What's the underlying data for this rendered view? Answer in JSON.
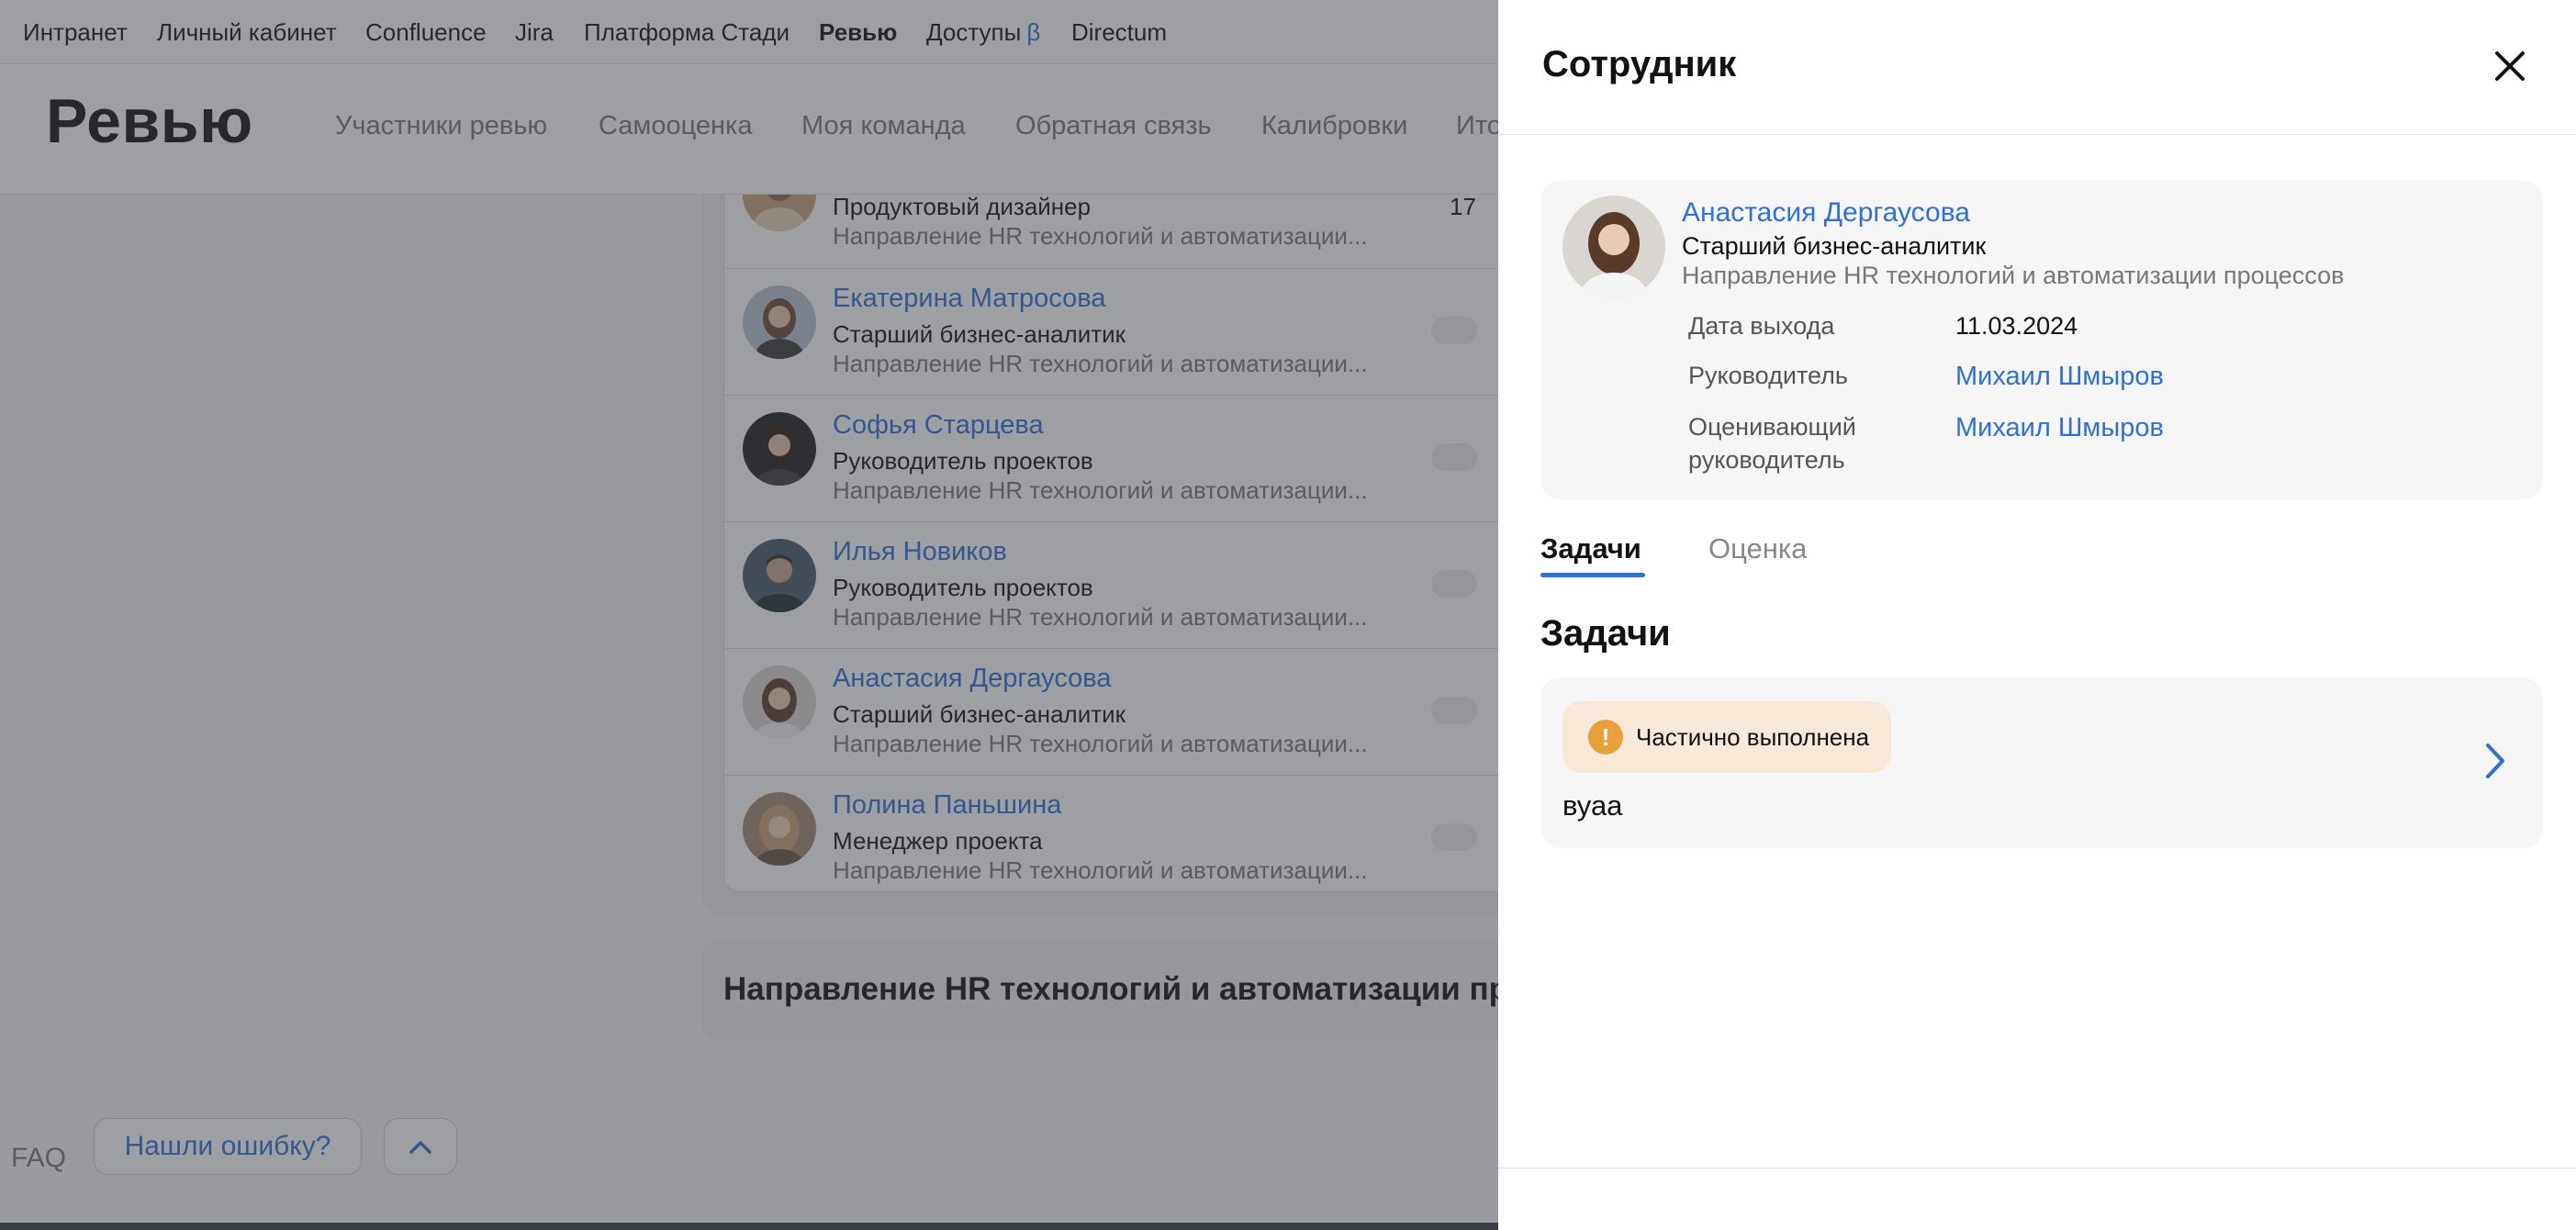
{
  "top_nav": {
    "items": [
      "Интранет",
      "Личный кабинет",
      "Confluence",
      "Jira",
      "Платформа Стади",
      "Ревью",
      "Доступы",
      "Directum"
    ],
    "active": "Ревью",
    "beta_mark": "β"
  },
  "page": {
    "title": "Ревью",
    "tabs": [
      "Участники ревью",
      "Самооценка",
      "Моя команда",
      "Обратная связь",
      "Калибровки",
      "Ито"
    ]
  },
  "employee_list": {
    "partial_row": {
      "role": "Продуктовый дизайнер",
      "department": "Направление HR технологий и автоматизации...",
      "count": "17"
    },
    "rows": [
      {
        "name": "Екатерина Матросова",
        "role": "Старший бизнес-аналитик",
        "department": "Направление HR технологий и автоматизации..."
      },
      {
        "name": "Софья Старцева",
        "role": "Руководитель проектов",
        "department": "Направление HR технологий и автоматизации..."
      },
      {
        "name": "Илья Новиков",
        "role": "Руководитель проектов",
        "department": "Направление HR технологий и автоматизации..."
      },
      {
        "name": "Анастасия Дергаусова",
        "role": "Старший бизнес-аналитик",
        "department": "Направление HR технологий и автоматизации..."
      },
      {
        "name": "Полина Паньшина",
        "role": "Менеджер проекта",
        "department": "Направление HR технологий и автоматизации..."
      }
    ]
  },
  "section_heading": "Направление HR технологий и автоматизации про",
  "footer": {
    "faq": "FAQ",
    "report_error": "Нашли ошибку?",
    "scroll_up_icon": "chevron-up-icon"
  },
  "drawer": {
    "title": "Сотрудник",
    "close_icon": "close-icon",
    "employee": {
      "name": "Анастасия Дергаусова",
      "role": "Старший бизнес-аналитик",
      "department": "Направление HR технологий и автоматизации процессов",
      "start_date_label": "Дата выхода",
      "start_date": "11.03.2024",
      "manager_label": "Руководитель",
      "manager": "Михаил Шмыров",
      "reviewer_label_line1": "Оценивающий",
      "reviewer_label_line2": "руководитель",
      "reviewer": "Михаил Шмыров"
    },
    "tabs": {
      "tasks": "Задачи",
      "assessment": "Оценка",
      "active": "Задачи"
    },
    "section_title": "Задачи",
    "task": {
      "status": "Частично выполнена",
      "status_icon_glyph": "!",
      "name": "вуаа"
    }
  },
  "colors": {
    "accent": "#2f6fd6",
    "badge_bg": "#f8e8d8",
    "badge_icon": "#e8a13a",
    "overlay": "#3c4048"
  }
}
